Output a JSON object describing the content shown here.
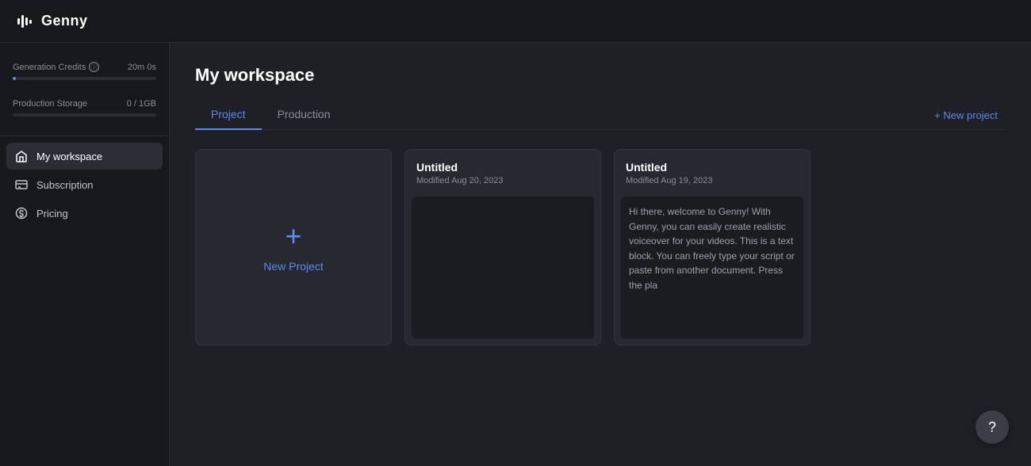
{
  "topbar": {
    "logo_text": "Genny",
    "logo_icon_alt": "genny-logo"
  },
  "sidebar": {
    "credits": {
      "label": "Generation Credits",
      "value": "20m 0s",
      "info_icon": "ⓘ",
      "progress_percent": 2
    },
    "storage": {
      "label": "Production Storage",
      "value": "0 / 1GB",
      "progress_percent": 0
    },
    "nav": [
      {
        "id": "my-workspace",
        "label": "My workspace",
        "icon": "home"
      },
      {
        "id": "subscription",
        "label": "Subscription",
        "icon": "subscription"
      },
      {
        "id": "pricing",
        "label": "Pricing",
        "icon": "pricing"
      }
    ]
  },
  "content": {
    "title": "My workspace",
    "tabs": [
      {
        "id": "project",
        "label": "Project",
        "active": true
      },
      {
        "id": "production",
        "label": "Production",
        "active": false
      }
    ],
    "new_project_btn": "+ New project",
    "cards": [
      {
        "id": "new-project-card",
        "type": "new",
        "plus": "+",
        "label": "New Project"
      },
      {
        "id": "card-1",
        "type": "project",
        "title": "Untitled",
        "date": "Modified Aug 20, 2023",
        "preview": ""
      },
      {
        "id": "card-2",
        "type": "project",
        "title": "Untitled",
        "date": "Modified Aug 19, 2023",
        "preview": "Hi there, welcome to Genny! With Genny, you can easily create realistic voiceover for your videos. This is a text block. You can freely type your script or paste from another document. Press the pla"
      }
    ]
  },
  "help": {
    "label": "?"
  }
}
